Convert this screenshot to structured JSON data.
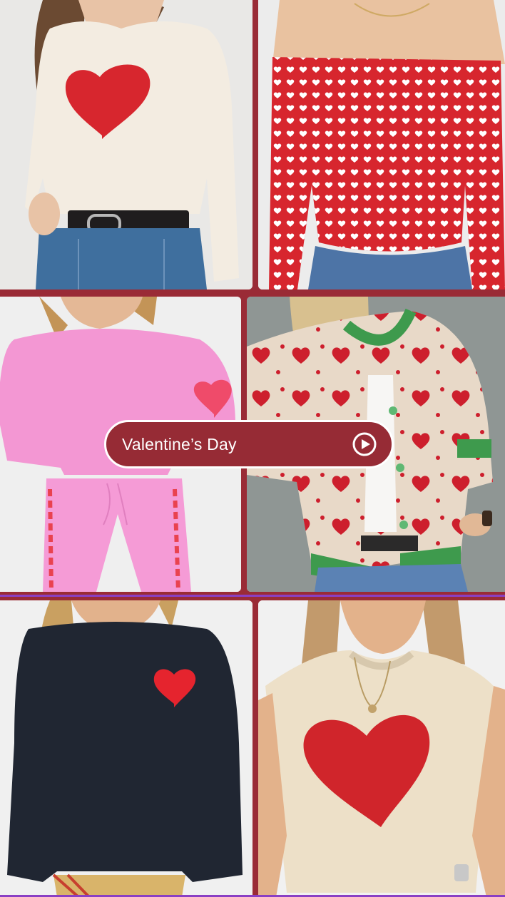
{
  "story_label": {
    "text": "Valentine’s Day",
    "icon": "play-circle-icon"
  },
  "tiles": [
    {
      "name": "cream-heart-sweater"
    },
    {
      "name": "red-heart-print-off-shoulder-top"
    },
    {
      "name": "pink-heart-elbow-sweatset"
    },
    {
      "name": "heart-knit-cardigan"
    },
    {
      "name": "navy-heart-sweatshirt"
    },
    {
      "name": "cream-heart-sweater-vest"
    }
  ],
  "colors": {
    "frame": "#9a2b36",
    "pill": "#962b35",
    "accent_line": "#8a3fc4",
    "heart_red": "#d7262e"
  }
}
